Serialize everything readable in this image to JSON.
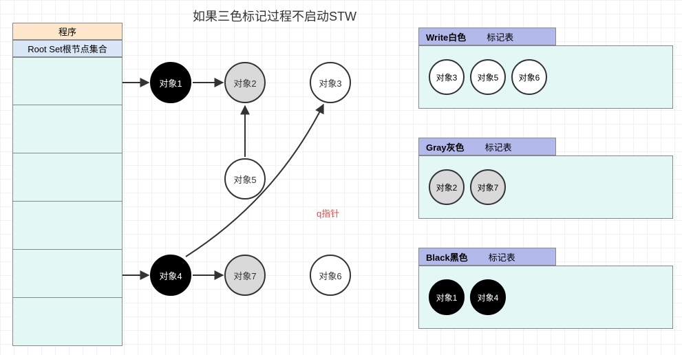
{
  "title": "如果三色标记过程不启动STW",
  "program_label": "程序",
  "rootset_label": "Root Set根节点集合",
  "q_pointer_label": "q指针",
  "objects": {
    "o1": "对象1",
    "o2": "对象2",
    "o3": "对象3",
    "o4": "对象4",
    "o5": "对象5",
    "o6": "对象6",
    "o7": "对象7"
  },
  "panels": {
    "white": {
      "title_bold": "Write白色",
      "title_rest": "标记表",
      "items": [
        "对象3",
        "对象5",
        "对象6"
      ]
    },
    "gray": {
      "title_bold": "Gray灰色",
      "title_rest": "标记表",
      "items": [
        "对象2",
        "对象7"
      ]
    },
    "black": {
      "title_bold": "Black黑色",
      "title_rest": "标记表",
      "items": [
        "对象1",
        "对象4"
      ]
    }
  },
  "chart_data": {
    "type": "graph",
    "title": "如果三色标记过程不启动STW",
    "nodes": [
      {
        "id": "对象1",
        "color": "black"
      },
      {
        "id": "对象2",
        "color": "gray"
      },
      {
        "id": "对象3",
        "color": "white"
      },
      {
        "id": "对象4",
        "color": "black"
      },
      {
        "id": "对象5",
        "color": "white"
      },
      {
        "id": "对象6",
        "color": "white"
      },
      {
        "id": "对象7",
        "color": "gray"
      }
    ],
    "edges": [
      {
        "from": "RootSet",
        "to": "对象1"
      },
      {
        "from": "RootSet",
        "to": "对象4"
      },
      {
        "from": "对象1",
        "to": "对象2"
      },
      {
        "from": "对象5",
        "to": "对象2"
      },
      {
        "from": "对象4",
        "to": "对象7"
      },
      {
        "from": "对象4",
        "to": "对象3",
        "label": "q指针"
      }
    ],
    "mark_tables": {
      "white": [
        "对象3",
        "对象5",
        "对象6"
      ],
      "gray": [
        "对象2",
        "对象7"
      ],
      "black": [
        "对象1",
        "对象4"
      ]
    }
  }
}
